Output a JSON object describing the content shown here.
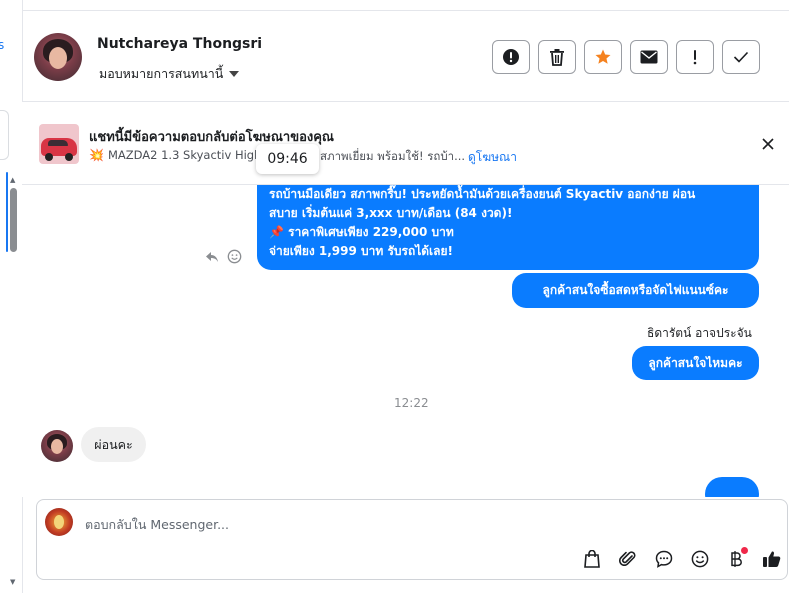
{
  "sidebar": {
    "edge_text": "s"
  },
  "header": {
    "contact_name": "Nutchareya Thongsri",
    "assign_label": "มอบหมายการสนทนานี้"
  },
  "actions": [
    "alert-circle-icon",
    "trash-icon",
    "star-icon",
    "mail-icon",
    "exclamation-icon",
    "check-icon"
  ],
  "ad": {
    "title": "แชทนี้มีข้อความตอบกลับต่อโฆษณาของคุณ",
    "subtitle_start": "MAZDA2 1.3 Skyactiv High",
    "subtitle_end": "สภาพเยี่ยม พร้อมใช้! รถบ้า...",
    "link": "ดูโฆษณา",
    "time_tooltip": "09:46"
  },
  "messages": {
    "ad_message_lines": [
      "รถบ้านมือเดียว สภาพกริ๊บ! ประหยัดน้ำมันด้วยเครื่องยนต์ Skyactiv ออกง่าย ผ่อน",
      "สบาย เริ่มต้นแค่ 3,xxx บาท/เดือน (84 งวด)!",
      "📌 ราคาพิเศษเพียง 229,000 บาท",
      "จ่ายเพียง 1,999 บาท รับรถได้เลย!"
    ],
    "out_1": "ลูกค้าสนใจซื้อสดหรือจัดไฟแนนซ์คะ",
    "sender_name": "ธิดารัตน์ อาจประจัน",
    "out_2": "ลูกค้าสนใจไหมคะ",
    "timestamp": "12:22",
    "in_1": "ผ่อนคะ"
  },
  "composer": {
    "placeholder": "ตอบกลับใน Messenger...",
    "tools": [
      "shopping-bag-icon",
      "paperclip-icon",
      "chat-bubble-icon",
      "emoji-icon",
      "baht-icon",
      "thumbs-up-icon"
    ]
  },
  "colors": {
    "accent": "#0a7cff",
    "star": "#f5821f"
  }
}
